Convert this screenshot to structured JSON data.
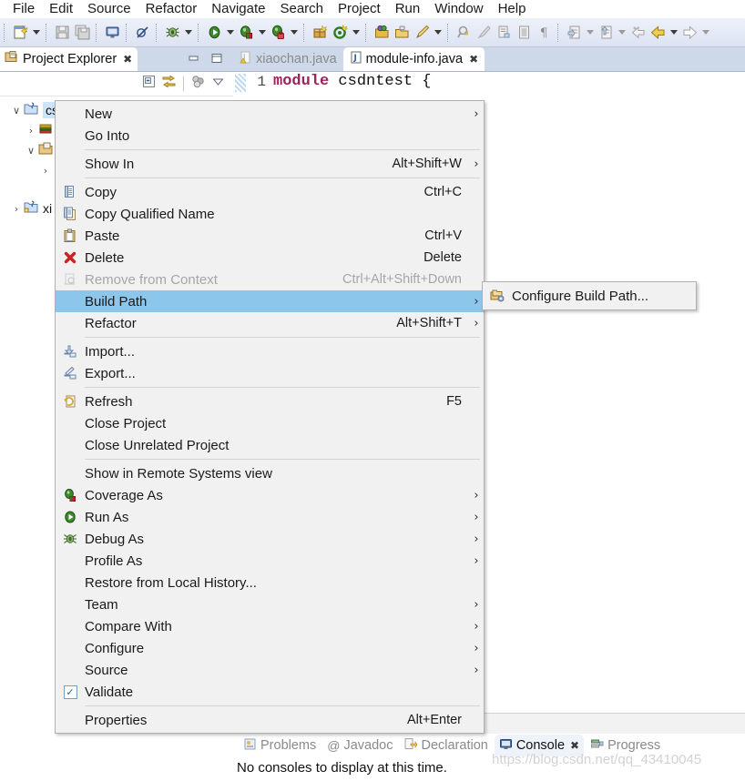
{
  "menubar": {
    "items": [
      {
        "label": "File"
      },
      {
        "label": "Edit"
      },
      {
        "label": "Source"
      },
      {
        "label": "Refactor"
      },
      {
        "label": "Navigate"
      },
      {
        "label": "Search"
      },
      {
        "label": "Project"
      },
      {
        "label": "Run"
      },
      {
        "label": "Window"
      },
      {
        "label": "Help"
      }
    ]
  },
  "toolbar": {
    "groups": [
      {
        "buttons": [
          {
            "icon": "new-wizard-icon",
            "arrow": true
          }
        ]
      },
      {
        "buttons": [
          {
            "icon": "save-icon",
            "arrow": false
          },
          {
            "icon": "save-all-icon",
            "arrow": false
          }
        ]
      },
      {
        "buttons": [
          {
            "icon": "new-java-console-icon",
            "arrow": false
          }
        ]
      },
      {
        "buttons": [
          {
            "icon": "skip-breakpoints-icon",
            "arrow": false
          }
        ]
      },
      {
        "buttons": [
          {
            "icon": "debug-icon",
            "arrow": true
          }
        ]
      },
      {
        "buttons": [
          {
            "icon": "run-icon",
            "arrow": true
          },
          {
            "icon": "coverage-icon",
            "arrow": true
          },
          {
            "icon": "run-last-icon",
            "arrow": true
          }
        ]
      },
      {
        "buttons": [
          {
            "icon": "new-package-icon",
            "arrow": false
          },
          {
            "icon": "new-class-icon",
            "arrow": true
          }
        ]
      },
      {
        "buttons": [
          {
            "icon": "open-type-icon",
            "arrow": false
          },
          {
            "icon": "open-task-icon",
            "arrow": false
          },
          {
            "icon": "edit-icon",
            "arrow": true
          }
        ]
      },
      {
        "buttons": [
          {
            "icon": "search-icon",
            "arrow": false
          },
          {
            "icon": "clear-icon",
            "arrow": false
          },
          {
            "icon": "next-annotation-icon",
            "arrow": false
          },
          {
            "icon": "toggle-block-icon",
            "arrow": false
          },
          {
            "icon": "pilcrow-icon",
            "arrow": false
          }
        ]
      },
      {
        "buttons": [
          {
            "icon": "next-edit-icon",
            "arrow": true
          },
          {
            "icon": "previous-edit-icon",
            "arrow": true
          },
          {
            "icon": "back-history-icon",
            "arrow": false
          },
          {
            "icon": "back-icon",
            "arrow": true
          },
          {
            "icon": "forward-icon",
            "arrow": true
          }
        ]
      }
    ]
  },
  "project_explorer": {
    "tab_label": "Project Explorer",
    "tab_close": "✖",
    "minimize_title": "Minimize",
    "maximize_title": "Maximize",
    "view_tools": [
      "collapse-all-icon",
      "link-with-editor-icon",
      "focus-icon",
      "view-menu-icon"
    ],
    "tree": [
      {
        "indent": 0,
        "twisty": "∨",
        "icon": "java-project-icon",
        "label": "cs",
        "selected": true
      },
      {
        "indent": 1,
        "twisty": "›",
        "icon": "jre-library-icon",
        "label": "",
        "selected": false
      },
      {
        "indent": 1,
        "twisty": "∨",
        "icon": "source-folder-icon",
        "label": "",
        "selected": false
      },
      {
        "indent": 2,
        "twisty": "›",
        "icon": "package-icon",
        "label": "",
        "selected": false
      },
      {
        "indent": 0,
        "twisty": "›",
        "icon": "java-project-icon",
        "label": "xi",
        "selected": false
      }
    ]
  },
  "editor": {
    "tabs": [
      {
        "label": "xiaochan.java",
        "active": false,
        "closable": false,
        "icon": "java-file-warning-icon"
      },
      {
        "label": "module-info.java",
        "active": true,
        "closable": true,
        "close": "✖",
        "icon": "java-file-icon"
      }
    ],
    "line_number": "1",
    "code_keyword": "module",
    "code_rest": " csdntest {",
    "hscroll_glyph": "‹"
  },
  "bottom_view": {
    "tabs": [
      {
        "label": "Problems",
        "icon": "problems-icon",
        "active": false
      },
      {
        "label": "Javadoc",
        "icon": "javadoc-icon",
        "active": false
      },
      {
        "label": "Declaration",
        "icon": "declaration-icon",
        "active": false
      },
      {
        "label": "Console",
        "icon": "console-icon",
        "active": true,
        "close": "✖"
      },
      {
        "label": "Progress",
        "icon": "progress-icon",
        "active": false
      }
    ],
    "body_text": "No consoles to display at this time."
  },
  "watermark": "https://blog.csdn.net/qq_43410045",
  "context_menu": {
    "items": [
      {
        "type": "item",
        "label": "New",
        "accel": "",
        "submenu": true,
        "icon": "",
        "disabled": false,
        "highlight": false,
        "name": "new"
      },
      {
        "type": "item",
        "label": "Go Into",
        "accel": "",
        "submenu": false,
        "icon": "",
        "disabled": false,
        "highlight": false,
        "name": "go-into"
      },
      {
        "type": "separator"
      },
      {
        "type": "item",
        "label": "Show In",
        "accel": "Alt+Shift+W",
        "submenu": true,
        "icon": "",
        "disabled": false,
        "highlight": false,
        "name": "show-in"
      },
      {
        "type": "separator"
      },
      {
        "type": "item",
        "label": "Copy",
        "accel": "Ctrl+C",
        "submenu": false,
        "icon": "copy-icon",
        "disabled": false,
        "highlight": false,
        "name": "copy"
      },
      {
        "type": "item",
        "label": "Copy Qualified Name",
        "accel": "",
        "submenu": false,
        "icon": "copy-qualified-name-icon",
        "disabled": false,
        "highlight": false,
        "name": "copy-qualified-name"
      },
      {
        "type": "item",
        "label": "Paste",
        "accel": "Ctrl+V",
        "submenu": false,
        "icon": "paste-icon",
        "disabled": false,
        "highlight": false,
        "name": "paste"
      },
      {
        "type": "item",
        "label": "Delete",
        "accel": "Delete",
        "submenu": false,
        "icon": "delete-icon",
        "disabled": false,
        "highlight": false,
        "name": "delete"
      },
      {
        "type": "item",
        "label": "Remove from Context",
        "accel": "Ctrl+Alt+Shift+Down",
        "submenu": false,
        "icon": "remove-from-context-icon",
        "disabled": true,
        "highlight": false,
        "name": "remove-from-context"
      },
      {
        "type": "item",
        "label": "Build Path",
        "accel": "",
        "submenu": true,
        "icon": "",
        "disabled": false,
        "highlight": true,
        "name": "build-path"
      },
      {
        "type": "item",
        "label": "Refactor",
        "accel": "Alt+Shift+T",
        "submenu": true,
        "icon": "",
        "disabled": false,
        "highlight": false,
        "name": "refactor"
      },
      {
        "type": "separator"
      },
      {
        "type": "item",
        "label": "Import...",
        "accel": "",
        "submenu": false,
        "icon": "import-icon",
        "disabled": false,
        "highlight": false,
        "name": "import"
      },
      {
        "type": "item",
        "label": "Export...",
        "accel": "",
        "submenu": false,
        "icon": "export-icon",
        "disabled": false,
        "highlight": false,
        "name": "export"
      },
      {
        "type": "separator"
      },
      {
        "type": "item",
        "label": "Refresh",
        "accel": "F5",
        "submenu": false,
        "icon": "refresh-icon",
        "disabled": false,
        "highlight": false,
        "name": "refresh"
      },
      {
        "type": "item",
        "label": "Close Project",
        "accel": "",
        "submenu": false,
        "icon": "",
        "disabled": false,
        "highlight": false,
        "name": "close-project"
      },
      {
        "type": "item",
        "label": "Close Unrelated Project",
        "accel": "",
        "submenu": false,
        "icon": "",
        "disabled": false,
        "highlight": false,
        "name": "close-unrelated-project"
      },
      {
        "type": "separator"
      },
      {
        "type": "item",
        "label": "Show in Remote Systems view",
        "accel": "",
        "submenu": false,
        "icon": "",
        "disabled": false,
        "highlight": false,
        "name": "show-in-remote-systems-view"
      },
      {
        "type": "item",
        "label": "Coverage As",
        "accel": "",
        "submenu": true,
        "icon": "coverage-icon",
        "disabled": false,
        "highlight": false,
        "name": "coverage-as"
      },
      {
        "type": "item",
        "label": "Run As",
        "accel": "",
        "submenu": true,
        "icon": "run-icon",
        "disabled": false,
        "highlight": false,
        "name": "run-as"
      },
      {
        "type": "item",
        "label": "Debug As",
        "accel": "",
        "submenu": true,
        "icon": "debug-icon",
        "disabled": false,
        "highlight": false,
        "name": "debug-as"
      },
      {
        "type": "item",
        "label": "Profile As",
        "accel": "",
        "submenu": true,
        "icon": "",
        "disabled": false,
        "highlight": false,
        "name": "profile-as"
      },
      {
        "type": "item",
        "label": "Restore from Local History...",
        "accel": "",
        "submenu": false,
        "icon": "",
        "disabled": false,
        "highlight": false,
        "name": "restore-from-local-history"
      },
      {
        "type": "item",
        "label": "Team",
        "accel": "",
        "submenu": true,
        "icon": "",
        "disabled": false,
        "highlight": false,
        "name": "team"
      },
      {
        "type": "item",
        "label": "Compare With",
        "accel": "",
        "submenu": true,
        "icon": "",
        "disabled": false,
        "highlight": false,
        "name": "compare-with"
      },
      {
        "type": "item",
        "label": "Configure",
        "accel": "",
        "submenu": true,
        "icon": "",
        "disabled": false,
        "highlight": false,
        "name": "configure"
      },
      {
        "type": "item",
        "label": "Source",
        "accel": "",
        "submenu": true,
        "icon": "",
        "disabled": false,
        "highlight": false,
        "name": "source"
      },
      {
        "type": "item",
        "label": "Validate",
        "accel": "",
        "submenu": false,
        "icon": "checkbox-checked-icon",
        "disabled": false,
        "highlight": false,
        "name": "validate"
      },
      {
        "type": "separator"
      },
      {
        "type": "item",
        "label": "Properties",
        "accel": "Alt+Enter",
        "submenu": false,
        "icon": "",
        "disabled": false,
        "highlight": false,
        "name": "properties"
      }
    ],
    "submenu_arrow": "›"
  },
  "submenu": {
    "items": [
      {
        "label": "Configure Build Path...",
        "icon": "configure-build-path-icon",
        "name": "configure-build-path"
      }
    ]
  },
  "colors": {
    "menu_highlight": "#8cc6ea",
    "menu_background": "#f1f1f1",
    "toolbar_background": "#e4e9f5",
    "tabbar_background": "#cdd9e8",
    "keyword": "#a0225c",
    "tree_selection": "#cde3f7",
    "watermark": "#d2d2d2"
  }
}
